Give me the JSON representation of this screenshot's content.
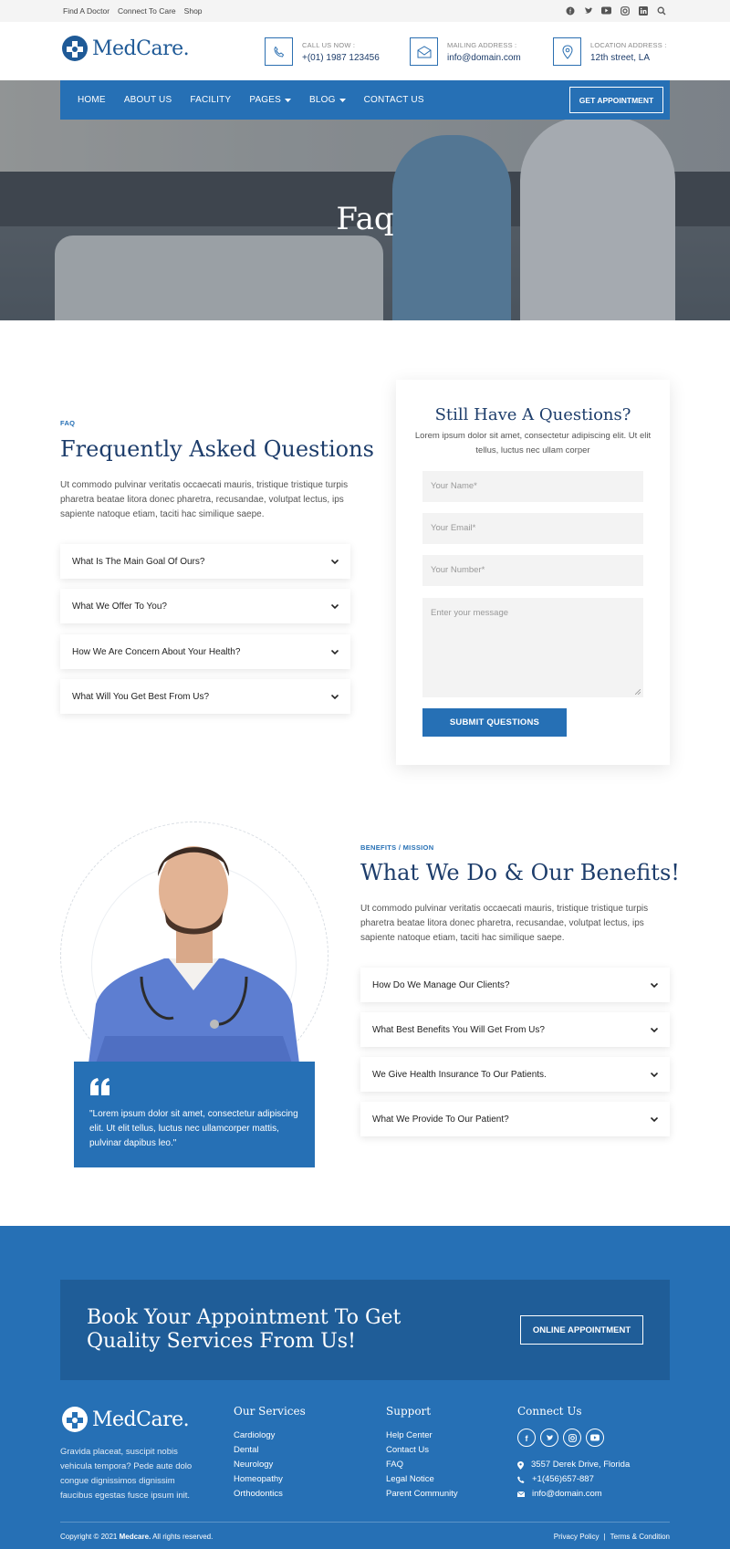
{
  "topbar": {
    "links": [
      "Find A Doctor",
      "Connect To Care",
      "Shop"
    ],
    "social_icons": [
      "facebook-icon",
      "twitter-icon",
      "youtube-icon",
      "instagram-icon",
      "linkedin-icon",
      "search-icon"
    ]
  },
  "brand": {
    "name": "MedCare.",
    "color": "#1f5a97",
    "accent": "#2670b5"
  },
  "header": {
    "contacts": [
      {
        "icon": "phone-icon",
        "label": "CALL US NOW :",
        "value": "+(01) 1987 123456"
      },
      {
        "icon": "mail-icon",
        "label": "MAILING ADDRESS :",
        "value": "info@domain.com"
      },
      {
        "icon": "location-icon",
        "label": "LOCATION ADDRESS :",
        "value": "12th street, LA"
      }
    ]
  },
  "nav": {
    "items": [
      "HOME",
      "ABOUT US",
      "FACILITY",
      "PAGES",
      "BLOG",
      "CONTACT US"
    ],
    "cta": "GET APPOINTMENT"
  },
  "hero": {
    "title": "Faq"
  },
  "faq": {
    "eyebrow": "FAQ",
    "title": "Frequently Asked Questions",
    "text": "Ut commodo pulvinar veritatis occaecati mauris, tristique tristique turpis pharetra beatae litora donec pharetra, recusandae, volutpat lectus, ips sapiente natoque etiam, taciti hac similique saepe.",
    "questions": [
      "What Is The Main Goal Of Ours?",
      "What We Offer To You?",
      "How We Are Concern About Your Health?",
      "What Will You Get Best From Us?"
    ]
  },
  "form": {
    "title": "Still Have A Questions?",
    "subtitle": "Lorem ipsum dolor sit amet, consectetur adipiscing elit. Ut elit tellus, luctus nec ullam corper",
    "name_placeholder": "Your Name*",
    "email_placeholder": "Your Email*",
    "number_placeholder": "Your Number*",
    "message_placeholder": "Enter your message",
    "submit": "SUBMIT QUESTIONS"
  },
  "benefits": {
    "eyebrow": "BENEFITS / MISSION",
    "title": "What We Do & Our Benefits!",
    "text": "Ut commodo pulvinar veritatis occaecati mauris, tristique tristique turpis pharetra beatae litora donec pharetra, recusandae, volutpat lectus, ips sapiente natoque etiam, taciti hac similique saepe.",
    "questions": [
      "How Do We Manage Our Clients?",
      "What Best Benefits You Will Get From Us?",
      "We Give Health Insurance To Our Patients.",
      "What We Provide To Our Patient?"
    ],
    "quote": "\"Lorem ipsum dolor sit amet, consectetur adipiscing elit. Ut elit tellus, luctus nec ullamcorper mattis, pulvinar dapibus leo.\""
  },
  "cta": {
    "title": "Book Your Appointment To Get Quality Services From Us!",
    "button": "ONLINE APPOINTMENT"
  },
  "footer": {
    "about": "Gravida placeat, suscipit nobis vehicula tempora? Pede aute dolo congue dignissimos dignissim faucibus egestas fusce ipsum init.",
    "services_title": "Our Services",
    "services": [
      "Cardiology",
      "Dental",
      "Neurology",
      "Homeopathy",
      "Orthodontics"
    ],
    "support_title": "Support",
    "support": [
      "Help Center",
      "Contact Us",
      "FAQ",
      "Legal Notice",
      "Parent Community"
    ],
    "connect_title": "Connect Us",
    "address": "3557 Derek Drive, Florida",
    "phone": "+1(456)657-887",
    "email": "info@domain.com",
    "copyright_prefix": "Copyright © 2021",
    "copyright_brand": "Medcare.",
    "copyright_suffix": "All rights reserved.",
    "privacy": "Privacy Policy",
    "terms": "Terms & Condition"
  }
}
